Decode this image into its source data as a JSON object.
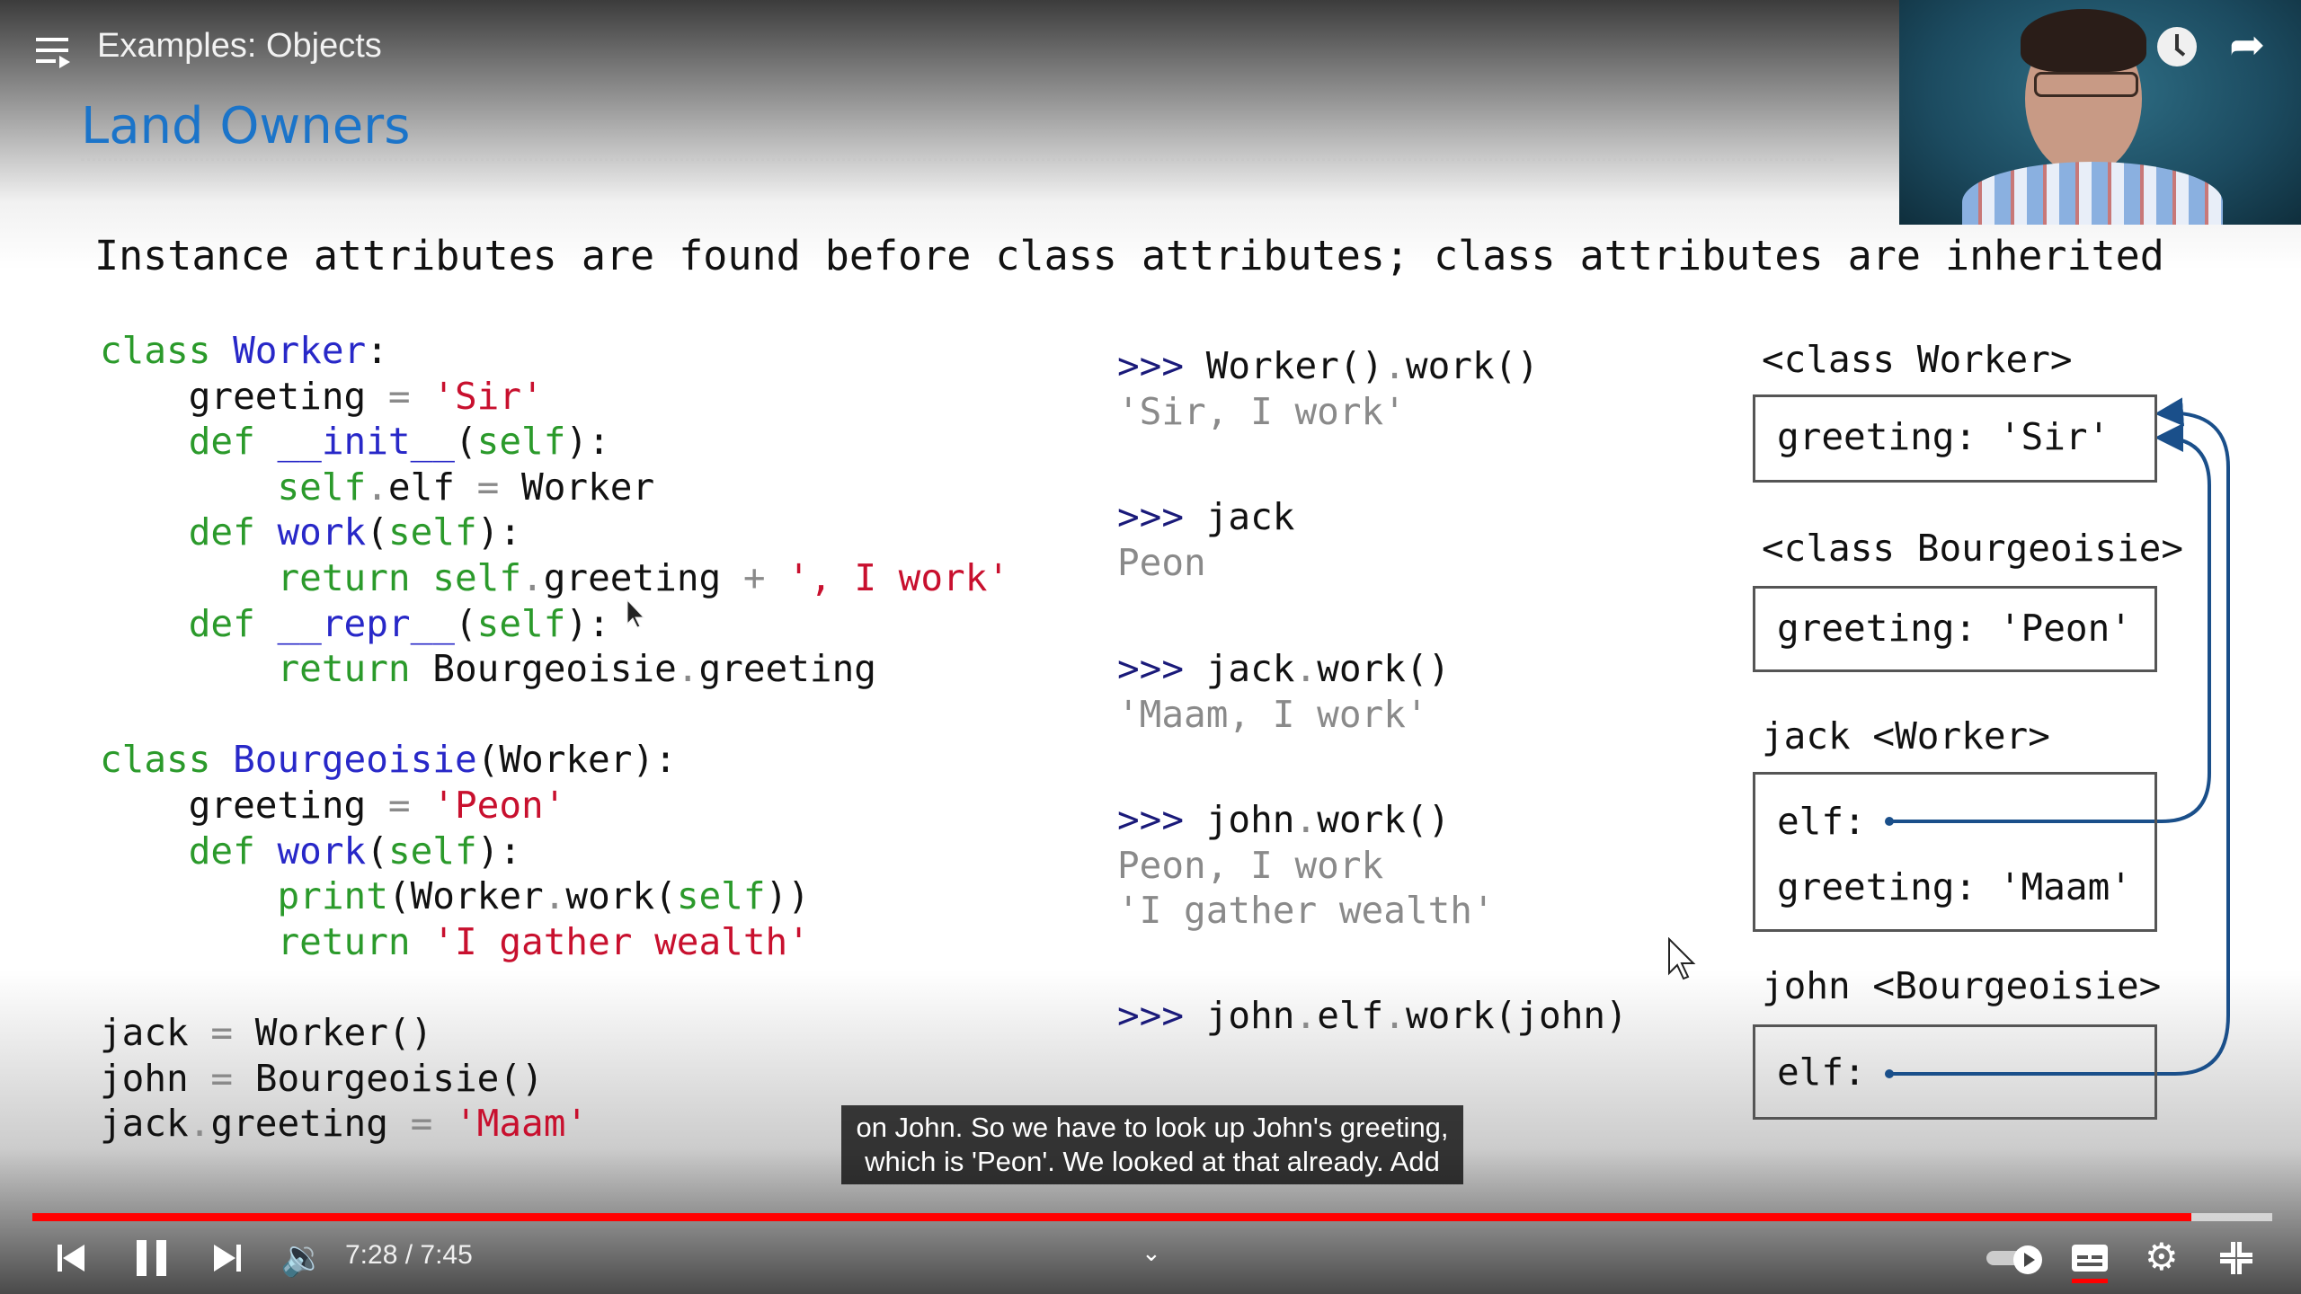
{
  "player": {
    "video_title": "Examples: Objects",
    "current_time": "7:28",
    "duration": "7:45",
    "time_display": "7:28 / 7:45",
    "progress_fraction": 0.964,
    "progress_color": "#ff0000",
    "captions_on": true,
    "autoplay_on": true,
    "icons": {
      "menu": "playlist-menu-icon",
      "watch_later": "clock-icon",
      "share": "share-arrow-icon",
      "previous": "skip-previous-icon",
      "pause": "pause-icon",
      "next": "skip-next-icon",
      "volume": "volume-icon",
      "chevron": "chevron-down-icon",
      "autoplay": "autoplay-toggle-icon",
      "captions": "captions-icon",
      "settings": "gear-icon",
      "exit_fullscreen": "exit-fullscreen-icon"
    }
  },
  "slide": {
    "title": "Land Owners",
    "title_color": "#1b74c9",
    "heading": "Instance attributes are found before class attributes; class attributes are inherited",
    "code": [
      [
        [
          "class",
          "k"
        ],
        [
          " ",
          "p"
        ],
        [
          "Worker",
          "n"
        ],
        [
          ":",
          "p"
        ]
      ],
      [
        [
          "    greeting ",
          "p"
        ],
        [
          "=",
          "o"
        ],
        [
          " ",
          "p"
        ],
        [
          "'Sir'",
          "s"
        ]
      ],
      [
        [
          "    ",
          "p"
        ],
        [
          "def",
          "k"
        ],
        [
          " ",
          "p"
        ],
        [
          "__init__",
          "n"
        ],
        [
          "(",
          "p"
        ],
        [
          "self",
          "k"
        ],
        [
          "):",
          "p"
        ]
      ],
      [
        [
          "        ",
          "p"
        ],
        [
          "self",
          "k"
        ],
        [
          ".",
          "o"
        ],
        [
          "elf ",
          "p"
        ],
        [
          "=",
          "o"
        ],
        [
          " Worker",
          "p"
        ]
      ],
      [
        [
          "    ",
          "p"
        ],
        [
          "def",
          "k"
        ],
        [
          " ",
          "p"
        ],
        [
          "work",
          "n"
        ],
        [
          "(",
          "p"
        ],
        [
          "self",
          "k"
        ],
        [
          "):",
          "p"
        ]
      ],
      [
        [
          "        ",
          "p"
        ],
        [
          "return",
          "k"
        ],
        [
          " ",
          "p"
        ],
        [
          "self",
          "k"
        ],
        [
          ".",
          "o"
        ],
        [
          "greeting ",
          "p"
        ],
        [
          "+",
          "o"
        ],
        [
          " ",
          "p"
        ],
        [
          "', I work'",
          "s"
        ]
      ],
      [
        [
          "    ",
          "p"
        ],
        [
          "def",
          "k"
        ],
        [
          " ",
          "p"
        ],
        [
          "__repr__",
          "n"
        ],
        [
          "(",
          "p"
        ],
        [
          "self",
          "k"
        ],
        [
          "):",
          "p"
        ]
      ],
      [
        [
          "        ",
          "p"
        ],
        [
          "return",
          "k"
        ],
        [
          " Bourgeoisie",
          "p"
        ],
        [
          ".",
          "o"
        ],
        [
          "greeting",
          "p"
        ]
      ],
      [],
      [
        [
          "class",
          "k"
        ],
        [
          " ",
          "p"
        ],
        [
          "Bourgeoisie",
          "n"
        ],
        [
          "(Worker):",
          "p"
        ]
      ],
      [
        [
          "    greeting ",
          "p"
        ],
        [
          "=",
          "o"
        ],
        [
          " ",
          "p"
        ],
        [
          "'Peon'",
          "s"
        ]
      ],
      [
        [
          "    ",
          "p"
        ],
        [
          "def",
          "k"
        ],
        [
          " ",
          "p"
        ],
        [
          "work",
          "n"
        ],
        [
          "(",
          "p"
        ],
        [
          "self",
          "k"
        ],
        [
          "):",
          "p"
        ]
      ],
      [
        [
          "        ",
          "p"
        ],
        [
          "print",
          "k"
        ],
        [
          "(Worker",
          "p"
        ],
        [
          ".",
          "o"
        ],
        [
          "work(",
          "p"
        ],
        [
          "self",
          "k"
        ],
        [
          "))",
          "p"
        ]
      ],
      [
        [
          "        ",
          "p"
        ],
        [
          "return",
          "k"
        ],
        [
          " ",
          "p"
        ],
        [
          "'I gather wealth'",
          "s"
        ]
      ],
      [],
      [
        [
          "jack ",
          "p"
        ],
        [
          "=",
          "o"
        ],
        [
          " Worker()",
          "p"
        ]
      ],
      [
        [
          "john ",
          "p"
        ],
        [
          "=",
          "o"
        ],
        [
          " Bourgeoisie()",
          "p"
        ]
      ],
      [
        [
          "jack",
          "p"
        ],
        [
          ".",
          "o"
        ],
        [
          "greeting ",
          "p"
        ],
        [
          "=",
          "o"
        ],
        [
          " ",
          "p"
        ],
        [
          "'Maam'",
          "s"
        ]
      ]
    ],
    "repl": [
      {
        "input": [
          [
            "Worker()",
            "p"
          ],
          [
            ".",
            "o"
          ],
          [
            "work()",
            "p"
          ]
        ],
        "output": [
          "'Sir, I work'"
        ]
      },
      {
        "input": [
          [
            "jack",
            "p"
          ]
        ],
        "output": [
          "Peon"
        ]
      },
      {
        "input": [
          [
            "jack",
            "p"
          ],
          [
            ".",
            "o"
          ],
          [
            "work()",
            "p"
          ]
        ],
        "output": [
          "'Maam, I work'"
        ]
      },
      {
        "input": [
          [
            "john",
            "p"
          ],
          [
            ".",
            "o"
          ],
          [
            "work()",
            "p"
          ]
        ],
        "output": [
          "Peon, I work",
          "'I gather wealth'"
        ]
      },
      {
        "input": [
          [
            "john",
            "p"
          ],
          [
            ".",
            "o"
          ],
          [
            "elf",
            "p"
          ],
          [
            ".",
            "o"
          ],
          [
            "work(john)",
            "p"
          ]
        ],
        "output": []
      }
    ],
    "prompt": ">>> ",
    "diagram": {
      "worker_label": "<class Worker>",
      "worker_attr": "greeting: 'Sir'",
      "bourgeoisie_label": "<class Bourgeoisie>",
      "bourgeoisie_attr": "greeting: 'Peon'",
      "jack_label": "jack <Worker>",
      "jack_elf": "elf:",
      "jack_greeting": "greeting: 'Maam'",
      "john_label": "john <Bourgeoisie>",
      "john_elf": "elf:",
      "arrow_color": "#1a4f8a"
    }
  },
  "captions": {
    "line1": "on John. So we have to look up John's greeting,",
    "line2": "which is 'Peon'. We looked at that already. Add"
  }
}
